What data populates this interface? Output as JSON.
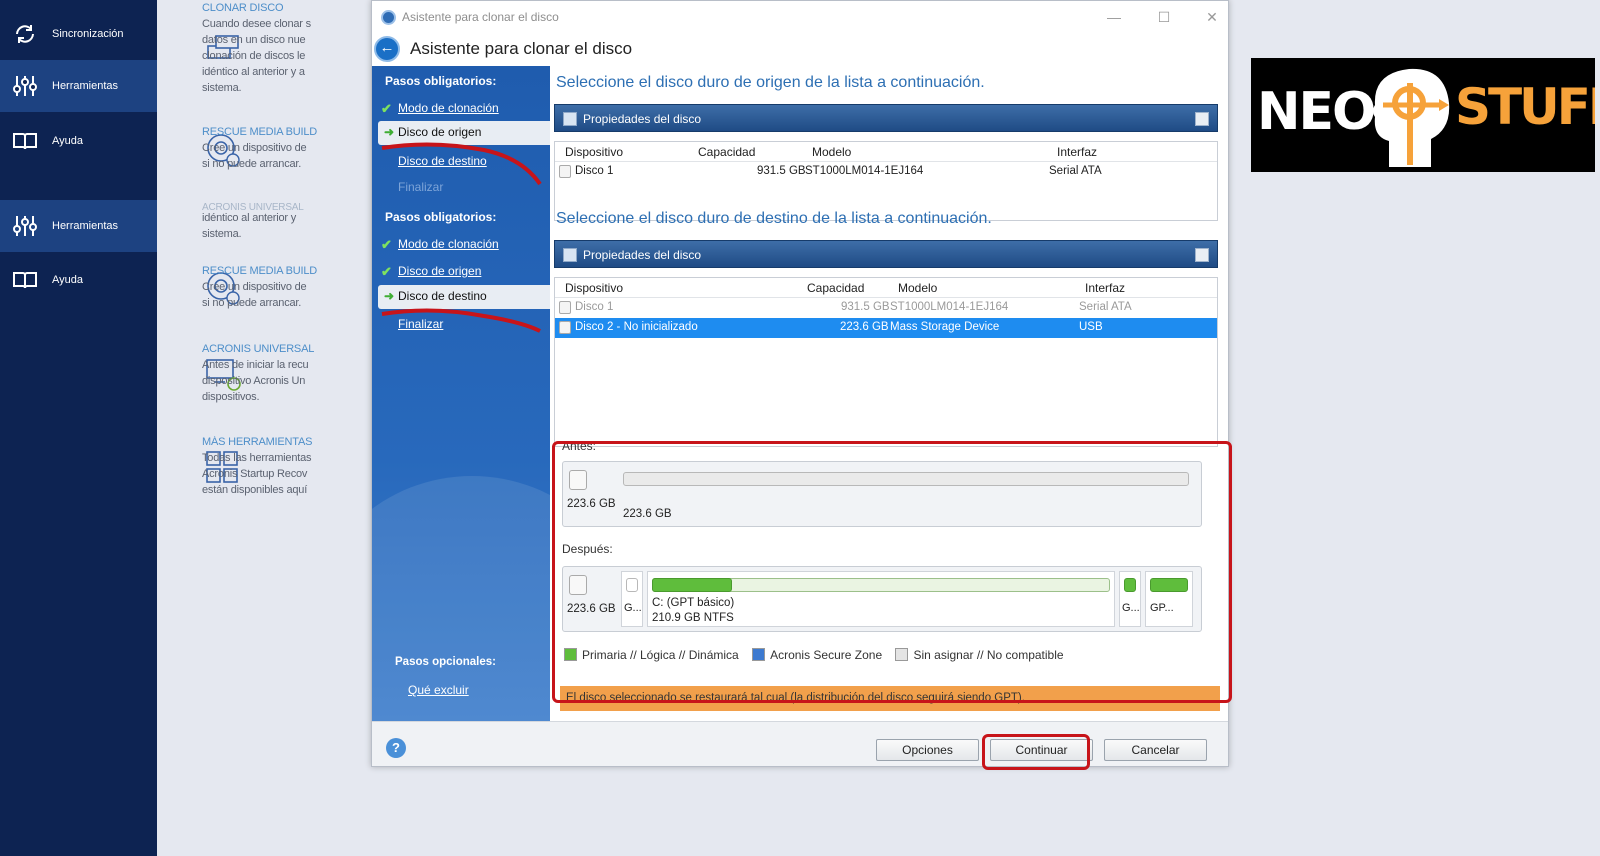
{
  "sidebar": {
    "items": [
      {
        "label": "Sincronización",
        "icon": "sync-icon"
      },
      {
        "label": "Herramientas",
        "icon": "tools-icon",
        "active": true
      },
      {
        "label": "Ayuda",
        "icon": "book-icon"
      },
      {
        "label": "Herramientas",
        "icon": "tools-icon",
        "active": true
      },
      {
        "label": "Ayuda",
        "icon": "book-icon"
      }
    ]
  },
  "background_tools": [
    {
      "title": "CLONAR DISCO",
      "desc": [
        "Cuando desee clonar s",
        "datos en un disco nue",
        "clonación de discos le",
        "idéntico al anterior y a",
        "sistema."
      ]
    },
    {
      "title": "RESCUE MEDIA BUILD",
      "desc": [
        "Cree un dispositivo de",
        "si no puede arrancar."
      ]
    },
    {
      "title": "ACRONIS UNIVERSAL",
      "desc": [
        "idéntico al anterior y",
        "sistema."
      ]
    },
    {
      "title": "RESCUE MEDIA BUILD",
      "desc": [
        "Cree un dispositivo de",
        "si no puede arrancar."
      ]
    },
    {
      "title": "ACRONIS UNIVERSAL",
      "desc": [
        "Antes de iniciar la recu",
        "dispositivo Acronis Un",
        "dispositivos."
      ]
    },
    {
      "title": "MÁS HERRAMIENTAS",
      "desc": [
        "Todas las herramientas",
        "Acronis Startup Recov",
        "están disponibles aquí"
      ]
    }
  ],
  "logo": {
    "left": "NEO",
    "right": "STUFF",
    "colors": {
      "accent": "#f6a23a",
      "bg": "#000000"
    }
  },
  "window": {
    "title": "Asistente para clonar el disco",
    "header": "Asistente para clonar el disco",
    "nav": {
      "section1": "Pasos obligatorios:",
      "s1_items": [
        "Modo de clonación",
        "Disco de origen",
        "Disco de destino",
        "Finalizar"
      ],
      "section2": "Pasos obligatorios:",
      "s2_items": [
        "Modo de clonación",
        "Disco de origen",
        "Disco de destino",
        "Finalizar"
      ],
      "optional": "Pasos opcionales:",
      "optional_item": "Qué excluir"
    },
    "source_prompt": "Seleccione el disco duro de origen de la lista a continuación.",
    "dest_prompt": "Seleccione el disco duro de destino de la lista a continuación.",
    "props_label": "Propiedades del disco",
    "columns": [
      "Dispositivo",
      "Capacidad",
      "Modelo",
      "Interfaz"
    ],
    "source_rows": [
      {
        "device": "Disco 1",
        "capacity": "931.5 GB",
        "model": "ST1000LM014-1EJ164",
        "iface": "Serial ATA"
      }
    ],
    "dest_rows": [
      {
        "device": "Disco 1",
        "capacity": "931.5 GB",
        "model": "ST1000LM014-1EJ164",
        "iface": "Serial ATA"
      },
      {
        "device": "Disco 2 - No inicializado",
        "capacity": "223.6 GB",
        "model": "Mass Storage Device",
        "iface": "USB"
      }
    ],
    "before_label": "Antes:",
    "after_label": "Después:",
    "before_disk": {
      "size": "223.6 GB",
      "bar_label": "223.6 GB"
    },
    "after_disk": {
      "size": "223.6 GB",
      "small1": "G...",
      "main_label": "C: (GPT básico)",
      "main_detail": "210.9 GB  NTFS",
      "small2": "G...",
      "small3": "GP..."
    },
    "legend": [
      "Primaria // Lógica // Dinámica",
      "Acronis Secure Zone",
      "Sin asignar // No compatible"
    ],
    "warning": "El disco seleccionado se restaurará tal cual (la distribución del disco seguirá siendo GPT).",
    "buttons": {
      "options": "Opciones",
      "continue": "Continuar",
      "cancel": "Cancelar"
    }
  }
}
